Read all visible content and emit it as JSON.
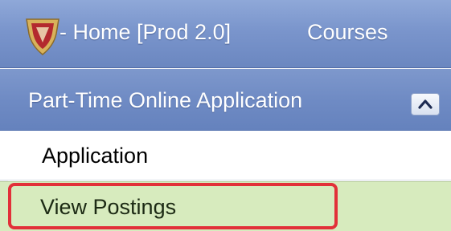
{
  "topbar": {
    "logo_icon": "shield-logo-icon",
    "home_label": "- Home [Prod 2.0]",
    "courses_label": "Courses"
  },
  "section": {
    "title": "Part-Time Online Application",
    "collapse_icon": "chevron-up-icon"
  },
  "menu": {
    "items": [
      {
        "label": "Application",
        "selected": false
      },
      {
        "label": "View Postings",
        "selected": true
      }
    ]
  },
  "colors": {
    "topbar": "#7a95cc",
    "section_header": "#6f8bc4",
    "selected_item_bg": "#d7ebbe",
    "highlight_outline": "#e23039",
    "logo_red": "#b32a2e",
    "logo_gold": "#d8b25a"
  }
}
